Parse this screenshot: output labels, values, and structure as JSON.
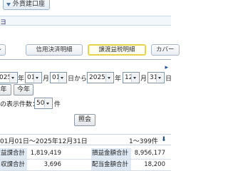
{
  "top_tab": {
    "label": "外貨建口座"
  },
  "header_glyph": "ヨ",
  "subtabs": [
    {
      "label": "レ"
    },
    {
      "label": "信用決済明細"
    },
    {
      "label": "譲渡益税明細"
    },
    {
      "label": "カバー"
    }
  ],
  "date_from": {
    "year": "025",
    "month": "01",
    "day": "01",
    "year_unit": "年",
    "month_unit": "月",
    "day_unit": "日"
  },
  "connector": "から",
  "date_to": {
    "year": "2025",
    "month": "12",
    "day": "31",
    "year_unit": "年",
    "month_unit": "月",
    "day_unit": "日"
  },
  "quick_buttons": {
    "last_year": "年",
    "this_year": "今年"
  },
  "per_page": {
    "label": "の表示件数：",
    "value": "50",
    "unit": "件"
  },
  "query_button": "照会",
  "results": {
    "period": "01月01日～2025年12月31日",
    "range": "1～399件",
    "download_icon": "download-icon"
  },
  "summary": [
    {
      "h1": "益課合計",
      "v1": "1,819,419",
      "h2": "損益金額合計",
      "v2": "8,956,177"
    },
    {
      "h1": "収課合計",
      "v1": "3,696",
      "h2": "配当金額合計",
      "v2": "18,200"
    }
  ]
}
